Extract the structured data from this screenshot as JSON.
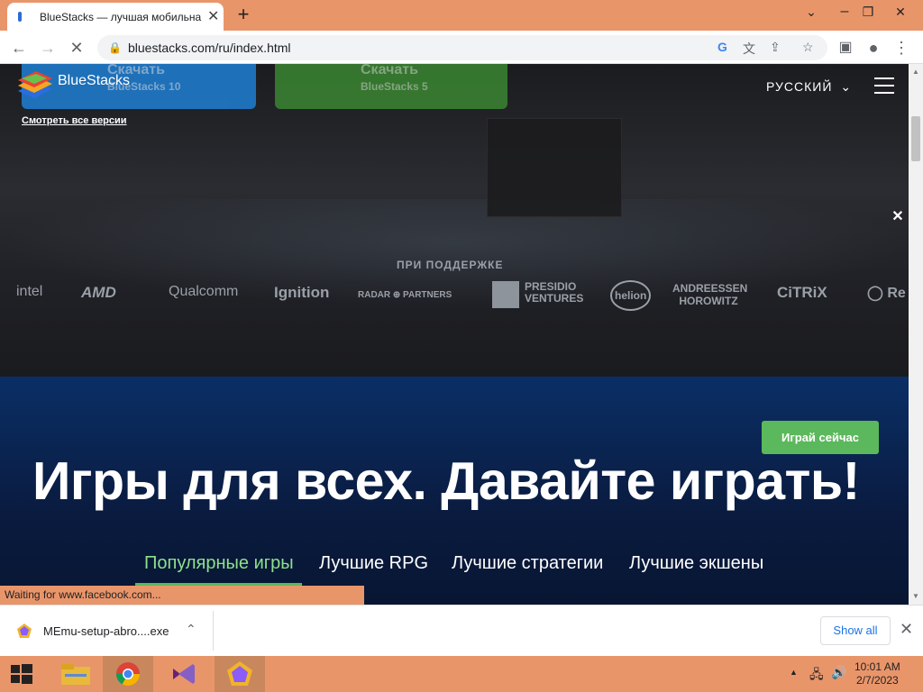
{
  "browser": {
    "tab_title": "BlueStacks — лучшая мобильна",
    "tab_close": "✕",
    "new_tab": "+",
    "url": "bluestacks.com/ru/index.html",
    "window_min": "⌄",
    "window_restore": "❐",
    "window_close": "✕"
  },
  "site": {
    "logo_text": "BlueStacks",
    "download_bs10": {
      "title": "Скачать",
      "subtitle": "BlueStacks 10"
    },
    "download_bs5": {
      "title": "Скачать",
      "subtitle": "BlueStacks 5"
    },
    "all_versions": "Смотреть все версии",
    "language": "РУССКИЙ",
    "supported_by": "ПРИ ПОДДЕРЖКЕ",
    "partners": [
      "intel",
      "AMD",
      "Qualcomm",
      "Ignition",
      "RADAR ⊕ PARTNERS",
      "PRESIDIO VENTURES",
      "helion",
      "ANDREESSEN HOROWITZ",
      "CiTRiX",
      "Re"
    ],
    "play_now": "Играй сейчас",
    "headline": "Игры для всех. Давайте играть!",
    "categories": [
      "Популярные игры",
      "Лучшие RPG",
      "Лучшие стратегии",
      "Лучшие экшены"
    ]
  },
  "status_text": "Waiting for www.facebook.com...",
  "download_bar": {
    "file_name": "MEmu-setup-abro....exe",
    "show_all": "Show all"
  },
  "taskbar": {
    "time": "10:01 AM",
    "date": "2/7/2023"
  }
}
